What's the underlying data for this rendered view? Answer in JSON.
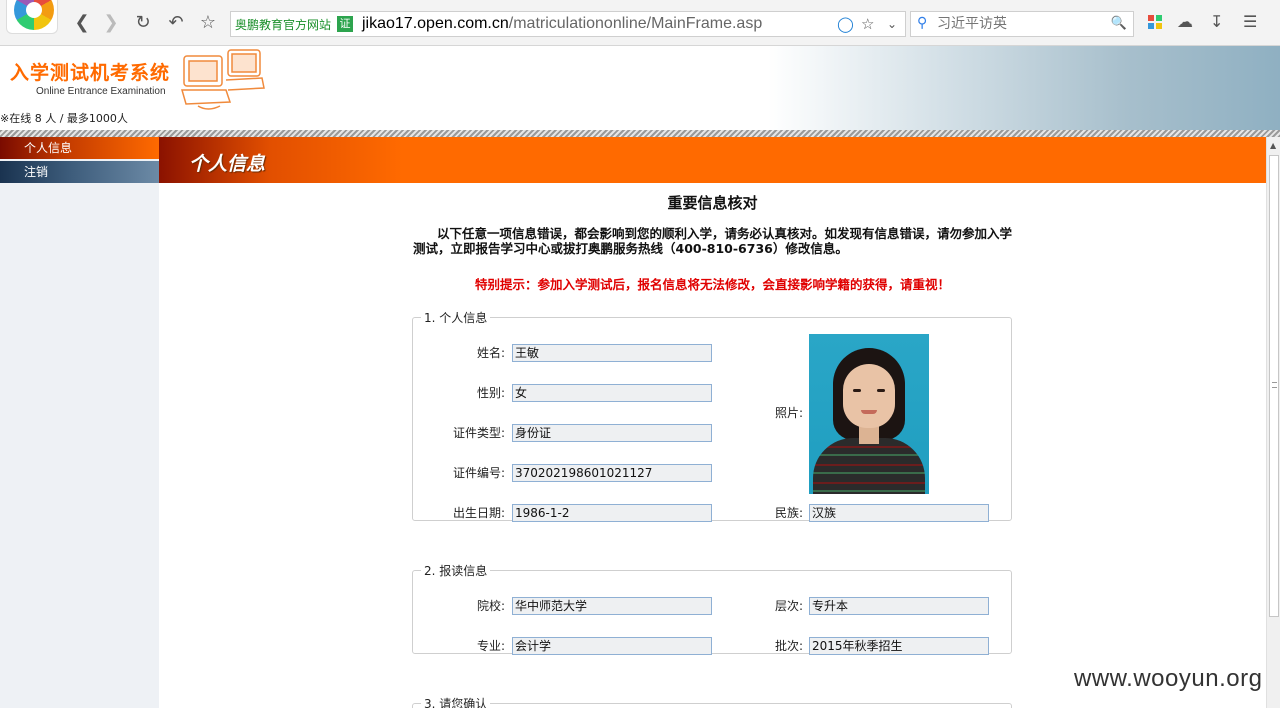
{
  "browser": {
    "site_badge": "奥鹏教育官方网站",
    "cert_label": "证",
    "url_host": "jikao17.open.com.cn",
    "url_path": "/matriculationonline/MainFrame.asp",
    "search_placeholder": "习近平访英",
    "accent_color": "#ff6a00"
  },
  "header": {
    "title": "入学测试机考系统",
    "subtitle": "Online Entrance Examination",
    "online_status": "※在线 8 人 / 最多1000人"
  },
  "sidebar": {
    "items": [
      {
        "label": "个人信息"
      },
      {
        "label": "注销"
      }
    ]
  },
  "main": {
    "section_title": "个人信息",
    "verify_title": "重要信息核对",
    "notice": "以下任意一项信息错误，都会影响到您的顺利入学，请务必认真核对。如发现有信息错误，请勿参加入学测试，立即报告学习中心或拔打奥鹏服务热线（400-810-6736）修改信息。",
    "warning": "特别提示：参加入学测试后，报名信息将无法修改，会直接影响学籍的获得，请重视！",
    "personal": {
      "legend": "1. 个人信息",
      "name_label": "姓名:",
      "name_value": "王敏",
      "gender_label": "性别:",
      "gender_value": "女",
      "idtype_label": "证件类型:",
      "idtype_value": "身份证",
      "idno_label": "证件编号:",
      "idno_value": "370202198601021127",
      "birth_label": "出生日期:",
      "birth_value": "1986-1-2",
      "photo_label": "照片:",
      "ethnic_label": "民族:",
      "ethnic_value": "汉族"
    },
    "enroll": {
      "legend": "2. 报读信息",
      "school_label": "院校:",
      "school_value": "华中师范大学",
      "level_label": "层次:",
      "level_value": "专升本",
      "major_label": "专业:",
      "major_value": "会计学",
      "batch_label": "批次:",
      "batch_value": "2015年秋季招生"
    },
    "confirm": {
      "legend": "3. 请您确认"
    }
  },
  "watermark": "www.wooyun.org"
}
